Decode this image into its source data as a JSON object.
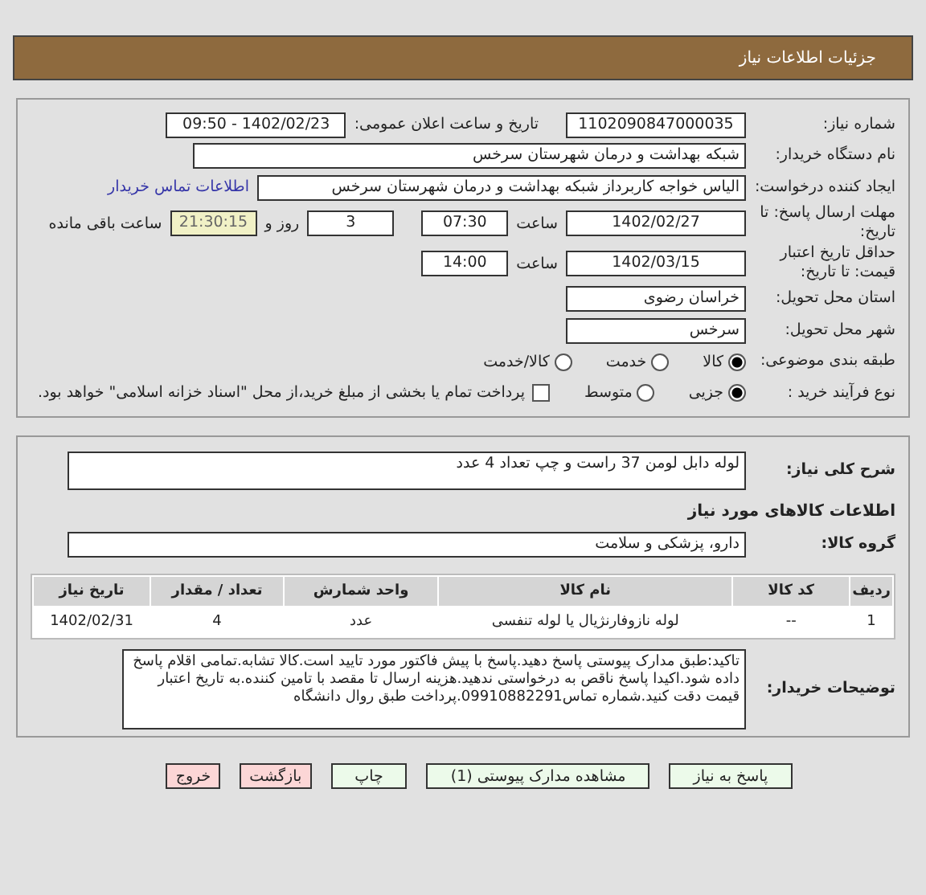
{
  "header": {
    "title": "جزئیات اطلاعات نیاز"
  },
  "need_number": {
    "label": "شماره نیاز:",
    "value": "1102090847000035"
  },
  "announce": {
    "label": "تاریخ و ساعت اعلان عمومی:",
    "value": "1402/02/23 - 09:50"
  },
  "buyer_org": {
    "label": "نام دستگاه خریدار:",
    "value": "شبکه بهداشت و درمان شهرستان سرخس"
  },
  "requester": {
    "label": "ایجاد کننده درخواست:",
    "value": "الیاس خواجه کاربرداز شبکه بهداشت و درمان شهرستان سرخس",
    "link": "اطلاعات تماس خریدار"
  },
  "deadline": {
    "label": "مهلت ارسال پاسخ: تا تاریخ:",
    "date": "1402/02/27",
    "time_label": "ساعت",
    "time": "07:30",
    "days": "3",
    "days_label": "روز و",
    "remaining": "21:30:15",
    "remaining_label": "ساعت باقی مانده"
  },
  "validity": {
    "label": "حداقل تاریخ اعتبار قیمت: تا تاریخ:",
    "date": "1402/03/15",
    "time_label": "ساعت",
    "time": "14:00"
  },
  "province": {
    "label": "استان محل تحویل:",
    "value": "خراسان رضوی"
  },
  "city": {
    "label": "شهر محل تحویل:",
    "value": "سرخس"
  },
  "category": {
    "label": "طبقه بندی موضوعی:",
    "options": [
      {
        "label": "کالا",
        "selected": true
      },
      {
        "label": "خدمت",
        "selected": false
      },
      {
        "label": "کالا/خدمت",
        "selected": false
      }
    ]
  },
  "process": {
    "label": "نوع فرآیند خرید :",
    "options": [
      {
        "label": "جزیی",
        "selected": true
      },
      {
        "label": "متوسط",
        "selected": false
      }
    ],
    "checkbox": {
      "checked": false,
      "text": "پرداخت تمام یا بخشی از مبلغ خرید،از محل \"اسناد خزانه اسلامی\" خواهد بود."
    }
  },
  "description": {
    "label": "شرح کلی نیاز:",
    "value": "لوله دابل لومن 37 راست و چپ تعداد 4 عدد"
  },
  "goods_heading": "اطلاعات کالاهای مورد نیاز",
  "goods_group": {
    "label": "گروه کالا:",
    "value": "دارو، پزشکی و سلامت"
  },
  "table": {
    "columns": [
      "ردیف",
      "کد کالا",
      "نام کالا",
      "واحد شمارش",
      "تعداد / مقدار",
      "تاریخ نیاز"
    ],
    "rows": [
      [
        "1",
        "--",
        "لوله نازوفارنژیال یا لوله تنفسی",
        "عدد",
        "4",
        "1402/02/31"
      ]
    ]
  },
  "buyer_notes": {
    "label": "توضیحات خریدار:",
    "value": "تاکید:طبق مدارک پیوستی پاسخ دهید.پاسخ با پیش فاکتور مورد تایید است.کالا تشابه.تمامی اقلام پاسخ داده شود.اکیدا پاسخ ناقص به درخواستی ندهید.هزینه ارسال تا مقصد با تامین کننده.به تاریخ اعتبار قیمت دقت کنید.شماره تماس09910882291.پرداخت طبق روال دانشگاه"
  },
  "buttons": [
    {
      "label": "پاسخ به نیاز",
      "kind": "green"
    },
    {
      "label": "مشاهده مدارک پیوستی (1)",
      "kind": "green"
    },
    {
      "label": "چاپ",
      "kind": "green"
    },
    {
      "label": "بازگشت",
      "kind": "red"
    },
    {
      "label": "خروج",
      "kind": "red"
    }
  ]
}
